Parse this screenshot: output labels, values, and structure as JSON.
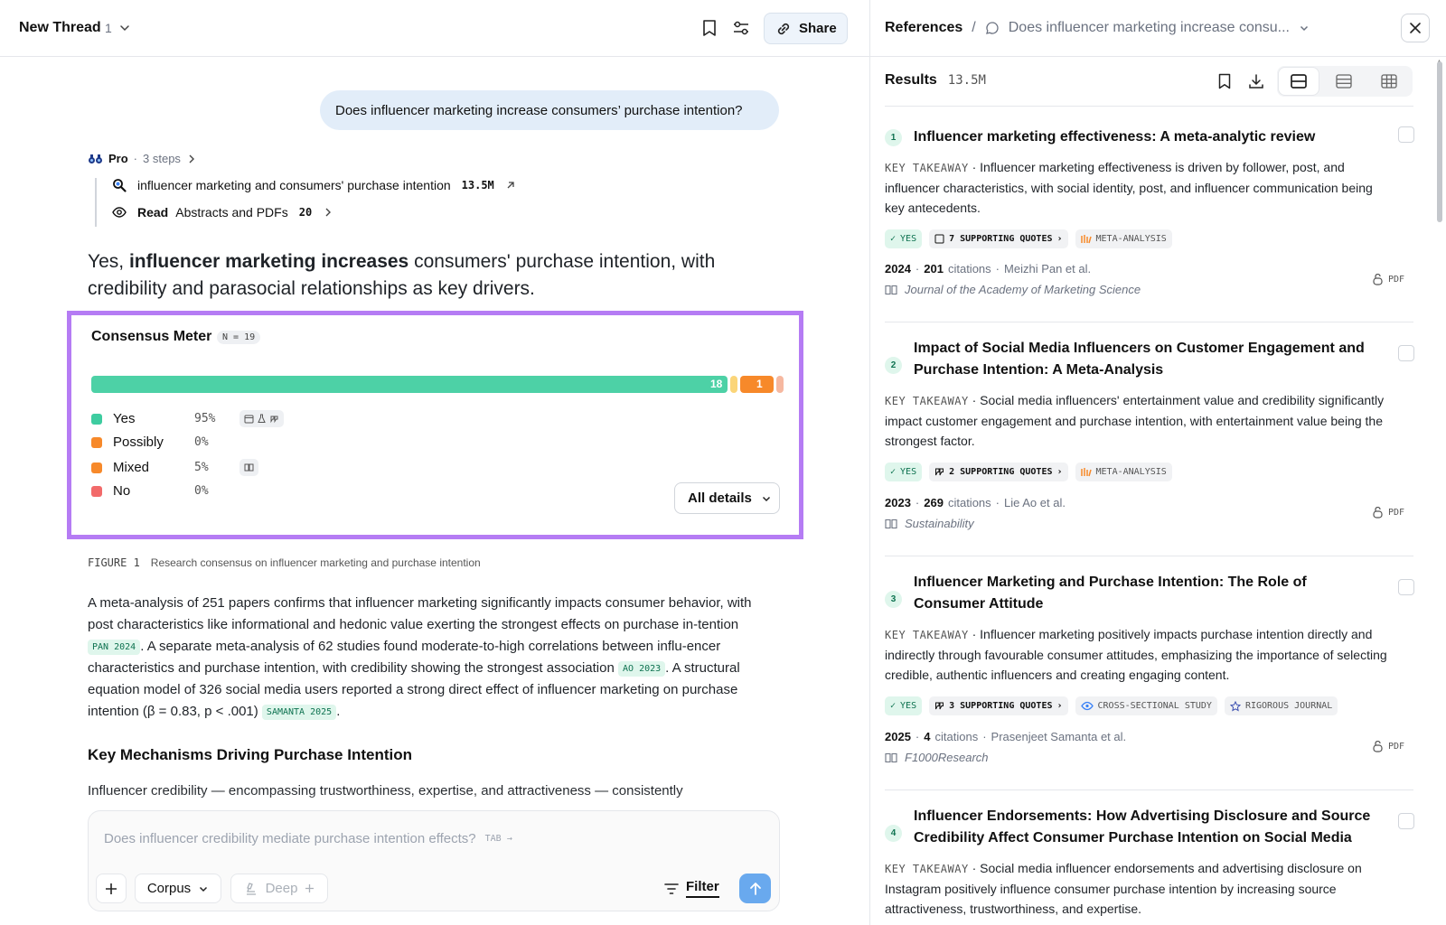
{
  "thread": {
    "title": "New Thread",
    "count": "1",
    "share_label": "Share"
  },
  "question": "Does influencer marketing increase consumers’ purchase intention?",
  "pro": {
    "label": "Pro",
    "steps": "3 steps",
    "search_query": "influencer marketing and consumers' purchase intention",
    "search_count": "13.5M",
    "read_label": "Read",
    "read_target": "Abstracts and PDFs",
    "read_count": "20"
  },
  "answer": {
    "prefix": "Yes, ",
    "bold": "influencer marketing increases",
    "suffix": " consumers' purchase intention, with credibility and parasocial relationships as key drivers."
  },
  "meter": {
    "title": "Consensus Meter",
    "n_label": "N = 19",
    "bar_yes_count": "18",
    "bar_mixed_count": "1",
    "rows": [
      {
        "label": "Yes",
        "pct": "95%",
        "color": "#3ecca0"
      },
      {
        "label": "Possibly",
        "pct": "0%",
        "color": "#f7892a"
      },
      {
        "label": "Mixed",
        "pct": "5%",
        "color": "#f7892a"
      },
      {
        "label": "No",
        "pct": "0%",
        "color": "#f26a6a"
      }
    ],
    "all_details": "All details",
    "colors": {
      "yes": "#4dd1a6",
      "possibly": "#fbd579",
      "mixed": "#f7892a",
      "no": "#f6b8a0"
    },
    "shares": {
      "yes": 0.95,
      "possibly": 0.0,
      "mixed": 0.05,
      "no": 0.0
    }
  },
  "figure": {
    "number": "FIGURE 1",
    "caption": "Research consensus on influencer marketing and purchase intention"
  },
  "body": {
    "p1_a": "A meta-analysis of 251 papers confirms that influencer marketing significantly impacts consumer behavior, with post characteristics like informational and hedonic value exerting the strongest effects on purchase in-tention ",
    "cite1_author": "PAN",
    "cite1_year": "2024",
    "p1_b": ". A separate meta-analysis of 62 studies found moderate-to-high correlations between influ-encer characteristics and purchase intention, with credibility showing the strongest association ",
    "cite2_author": "AO",
    "cite2_year": "2023",
    "p1_c": ". A structural equation model of 326 social media users reported a strong direct effect of influencer marketing on purchase intention (β = 0.83, p < .001) ",
    "cite3_author": "SAMANTA",
    "cite3_year": "2025",
    "p1_d": ".",
    "heading": "Key Mechanisms Driving Purchase Intention",
    "p2": "Influencer credibility — encompassing trustworthiness, expertise, and attractiveness — consistently"
  },
  "composer": {
    "placeholder": "Does influencer credibility mediate purchase intention effects?",
    "tab_hint": "TAB →",
    "corpus_label": "Corpus",
    "deep_label": "Deep",
    "filter_label": "Filter"
  },
  "references": {
    "title": "References",
    "thread_question": "Does influencer marketing increase consu...",
    "results_label": "Results",
    "results_count": "13.5M",
    "key_takeaway_label": "KEY TAKEAWAY",
    "pdf_label": "PDF",
    "items": [
      {
        "num": "1",
        "title": "Influencer marketing effectiveness: A meta-analytic review",
        "takeaway": "Influencer marketing effectiveness is driven by follower, post, and influencer characteristics, with social identity, post, and influencer communication being key antecedents.",
        "verdict": "YES",
        "quotes": "7 SUPPORTING QUOTES",
        "study_type": "META-ANALYSIS",
        "extra_tag": "",
        "year": "2024",
        "citations": "201",
        "citations_label": "citations",
        "authors": "Meizhi Pan et al.",
        "journal": "Journal of the Academy of Marketing Science"
      },
      {
        "num": "2",
        "title": "Impact of Social Media Influencers on Customer Engagement and Purchase Intention: A Meta-Analysis",
        "takeaway": "Social media influencers' entertainment value and credibility significantly impact customer engagement and purchase intention, with entertainment value being the strongest factor.",
        "verdict": "YES",
        "quotes": "2 SUPPORTING QUOTES",
        "study_type": "META-ANALYSIS",
        "extra_tag": "",
        "year": "2023",
        "citations": "269",
        "citations_label": "citations",
        "authors": "Lie Ao et al.",
        "journal": "Sustainability"
      },
      {
        "num": "3",
        "title": "Influencer Marketing and Purchase Intention: The Role of Consumer Attitude",
        "takeaway": "Influencer marketing positively impacts purchase intention directly and indirectly through favourable consumer attitudes, emphasizing the importance of selecting credible, authentic influencers and creating engaging content.",
        "verdict": "YES",
        "quotes": "3 SUPPORTING QUOTES",
        "study_type": "CROSS-SECTIONAL STUDY",
        "extra_tag": "RIGOROUS JOURNAL",
        "year": "2025",
        "citations": "4",
        "citations_label": "citations",
        "authors": "Prasenjeet Samanta et al.",
        "journal": "F1000Research"
      },
      {
        "num": "4",
        "title": "Influencer Endorsements: How Advertising Disclosure and Source Credibility Affect Consumer Purchase Intention on Social Media",
        "takeaway": "Social media influencer endorsements and advertising disclosure on Instagram positively influence consumer purchase intention by increasing source attractiveness, trustworthiness, and expertise."
      }
    ]
  }
}
